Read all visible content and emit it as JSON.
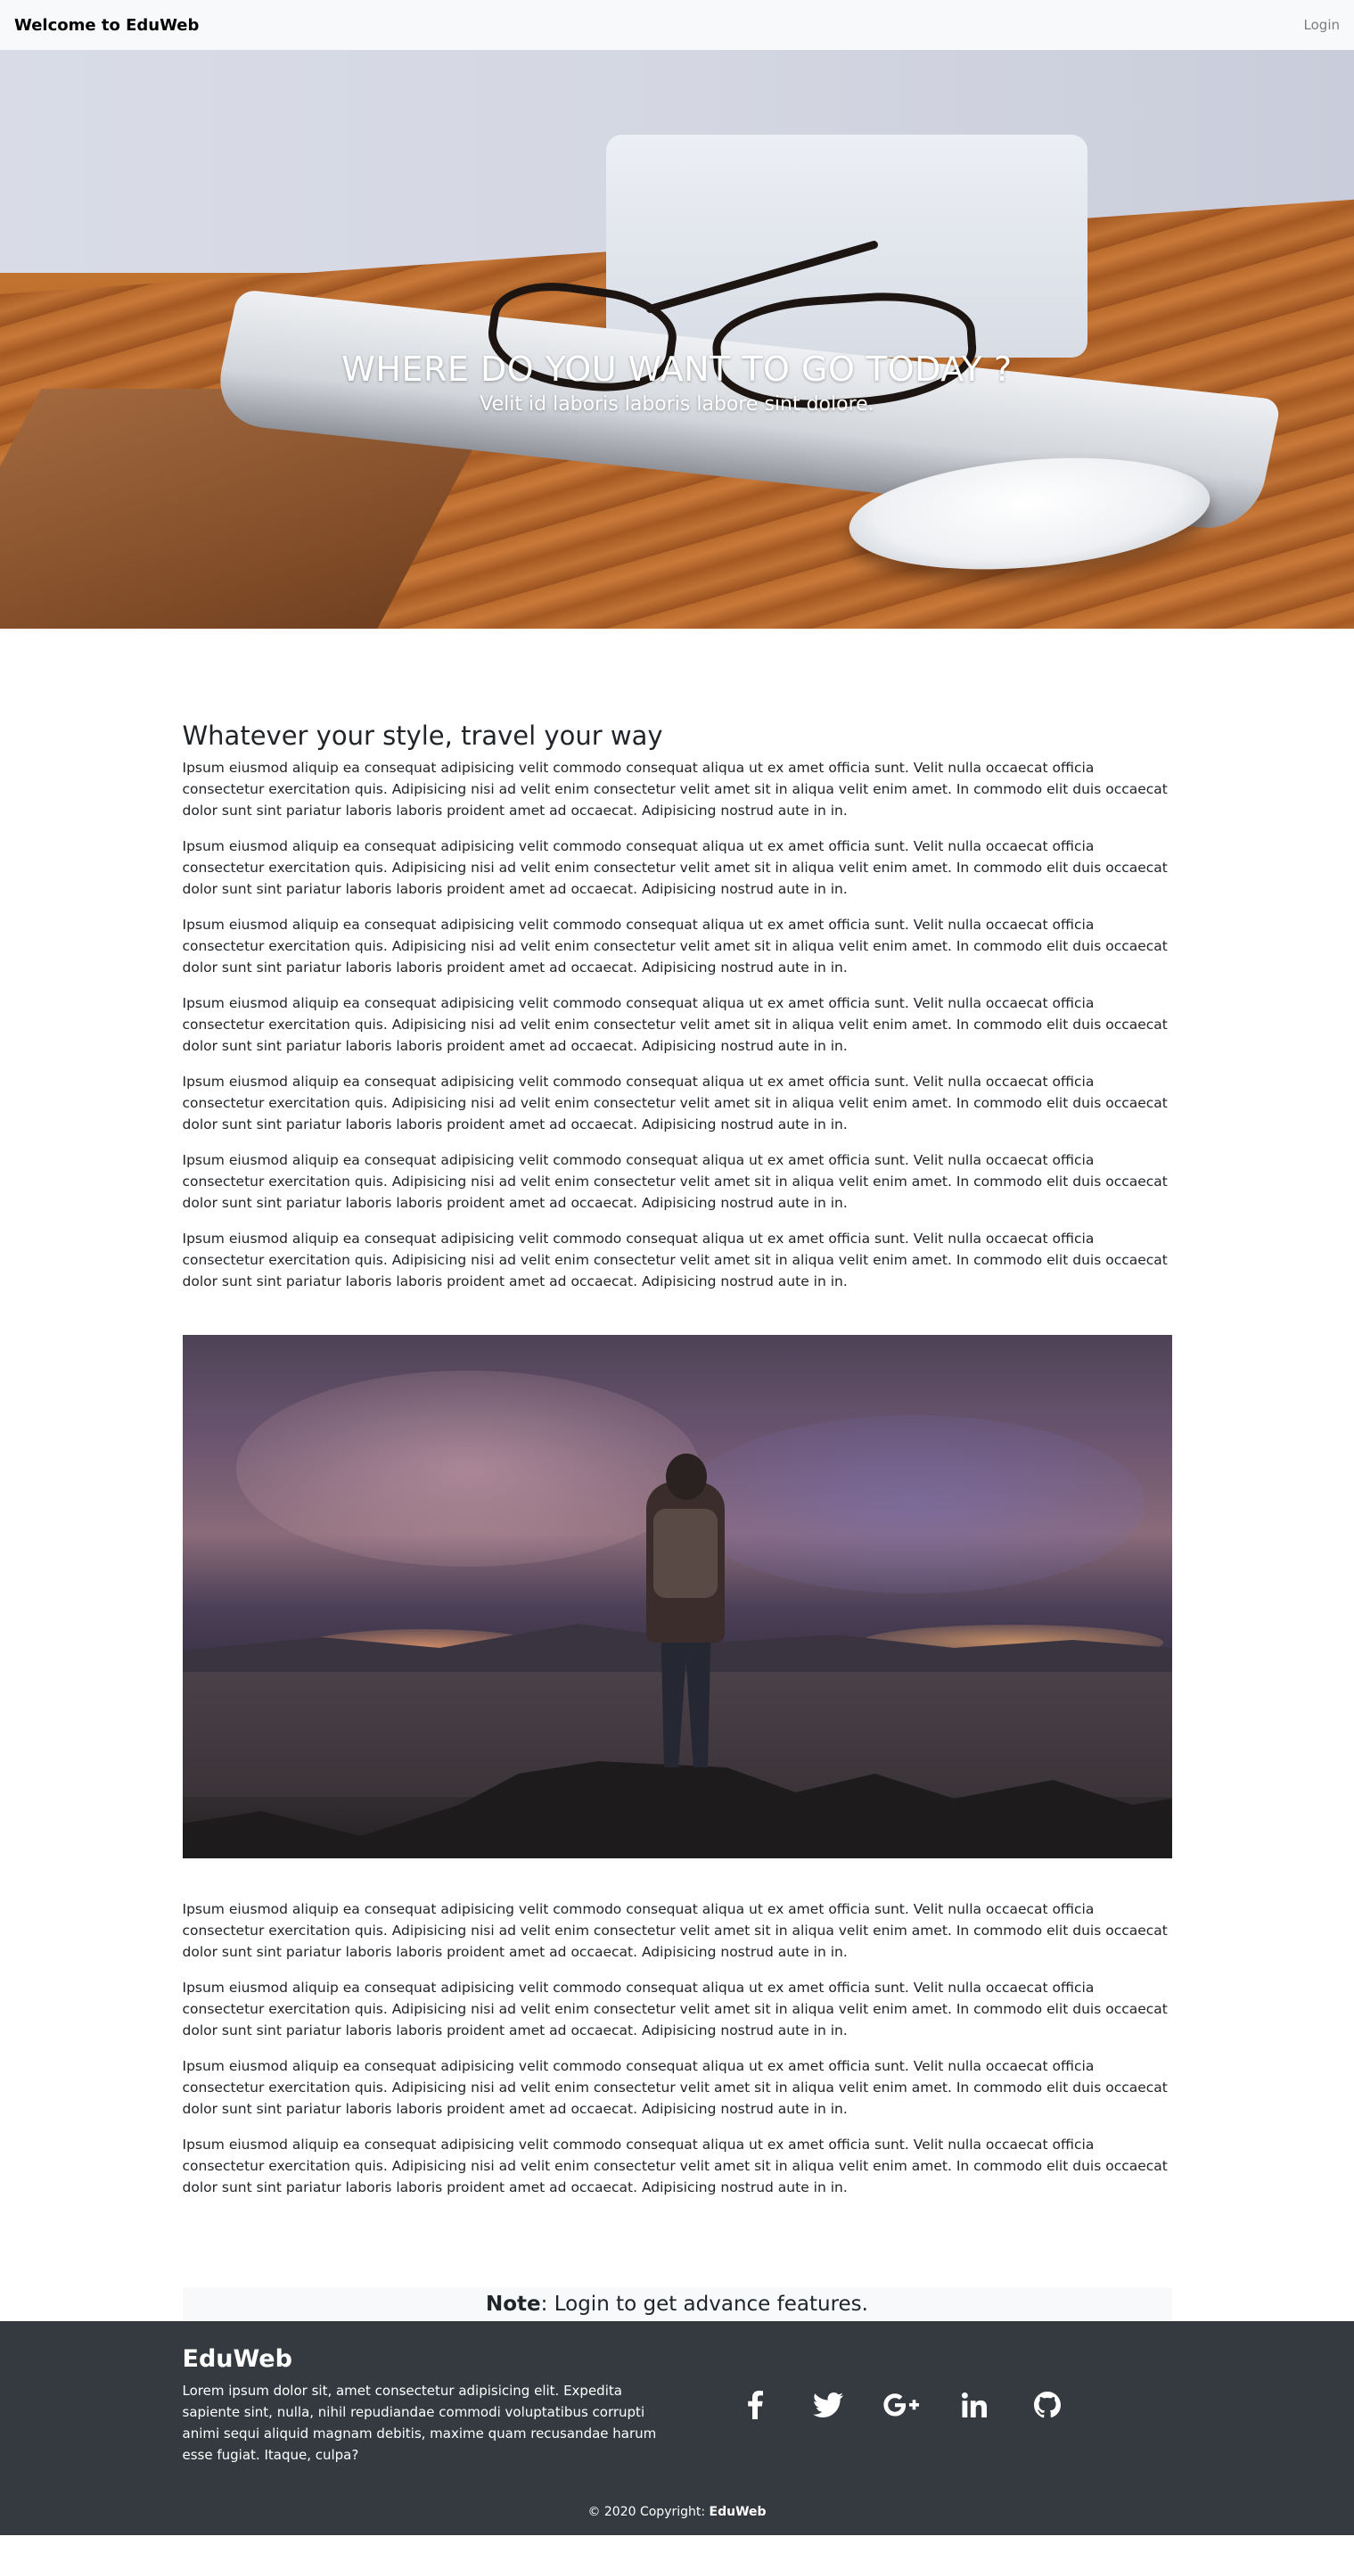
{
  "navbar": {
    "brand": "Welcome to EduWeb",
    "login": "Login"
  },
  "hero": {
    "title": "WHERE DO YOU WANT TO GO TODAY ?",
    "subtitle": "Velit id laboris laboris labore sint dolore."
  },
  "content": {
    "section_title": "Whatever your style, travel your way",
    "paragraphs_top": [
      "Ipsum eiusmod aliquip ea consequat adipisicing velit commodo consequat aliqua ut ex amet officia sunt. Velit nulla occaecat officia consectetur exercitation quis. Adipisicing nisi ad velit enim consectetur velit amet sit in aliqua velit enim amet. In commodo elit duis occaecat dolor sunt sint pariatur laboris laboris proident amet ad occaecat. Adipisicing nostrud aute in in.",
      "Ipsum eiusmod aliquip ea consequat adipisicing velit commodo consequat aliqua ut ex amet officia sunt. Velit nulla occaecat officia consectetur exercitation quis. Adipisicing nisi ad velit enim consectetur velit amet sit in aliqua velit enim amet. In commodo elit duis occaecat dolor sunt sint pariatur laboris laboris proident amet ad occaecat. Adipisicing nostrud aute in in.",
      "Ipsum eiusmod aliquip ea consequat adipisicing velit commodo consequat aliqua ut ex amet officia sunt. Velit nulla occaecat officia consectetur exercitation quis. Adipisicing nisi ad velit enim consectetur velit amet sit in aliqua velit enim amet. In commodo elit duis occaecat dolor sunt sint pariatur laboris laboris proident amet ad occaecat. Adipisicing nostrud aute in in.",
      "Ipsum eiusmod aliquip ea consequat adipisicing velit commodo consequat aliqua ut ex amet officia sunt. Velit nulla occaecat officia consectetur exercitation quis. Adipisicing nisi ad velit enim consectetur velit amet sit in aliqua velit enim amet. In commodo elit duis occaecat dolor sunt sint pariatur laboris laboris proident amet ad occaecat. Adipisicing nostrud aute in in.",
      "Ipsum eiusmod aliquip ea consequat adipisicing velit commodo consequat aliqua ut ex amet officia sunt. Velit nulla occaecat officia consectetur exercitation quis. Adipisicing nisi ad velit enim consectetur velit amet sit in aliqua velit enim amet. In commodo elit duis occaecat dolor sunt sint pariatur laboris laboris proident amet ad occaecat. Adipisicing nostrud aute in in.",
      "Ipsum eiusmod aliquip ea consequat adipisicing velit commodo consequat aliqua ut ex amet officia sunt. Velit nulla occaecat officia consectetur exercitation quis. Adipisicing nisi ad velit enim consectetur velit amet sit in aliqua velit enim amet. In commodo elit duis occaecat dolor sunt sint pariatur laboris laboris proident amet ad occaecat. Adipisicing nostrud aute in in.",
      "Ipsum eiusmod aliquip ea consequat adipisicing velit commodo consequat aliqua ut ex amet officia sunt. Velit nulla occaecat officia consectetur exercitation quis. Adipisicing nisi ad velit enim consectetur velit amet sit in aliqua velit enim amet. In commodo elit duis occaecat dolor sunt sint pariatur laboris laboris proident amet ad occaecat. Adipisicing nostrud aute in in."
    ],
    "paragraphs_bottom": [
      "Ipsum eiusmod aliquip ea consequat adipisicing velit commodo consequat aliqua ut ex amet officia sunt. Velit nulla occaecat officia consectetur exercitation quis. Adipisicing nisi ad velit enim consectetur velit amet sit in aliqua velit enim amet. In commodo elit duis occaecat dolor sunt sint pariatur laboris laboris proident amet ad occaecat. Adipisicing nostrud aute in in.",
      "Ipsum eiusmod aliquip ea consequat adipisicing velit commodo consequat aliqua ut ex amet officia sunt. Velit nulla occaecat officia consectetur exercitation quis. Adipisicing nisi ad velit enim consectetur velit amet sit in aliqua velit enim amet. In commodo elit duis occaecat dolor sunt sint pariatur laboris laboris proident amet ad occaecat. Adipisicing nostrud aute in in.",
      "Ipsum eiusmod aliquip ea consequat adipisicing velit commodo consequat aliqua ut ex amet officia sunt. Velit nulla occaecat officia consectetur exercitation quis. Adipisicing nisi ad velit enim consectetur velit amet sit in aliqua velit enim amet. In commodo elit duis occaecat dolor sunt sint pariatur laboris laboris proident amet ad occaecat. Adipisicing nostrud aute in in.",
      "Ipsum eiusmod aliquip ea consequat adipisicing velit commodo consequat aliqua ut ex amet officia sunt. Velit nulla occaecat officia consectetur exercitation quis. Adipisicing nisi ad velit enim consectetur velit amet sit in aliqua velit enim amet. In commodo elit duis occaecat dolor sunt sint pariatur laboris laboris proident amet ad occaecat. Adipisicing nostrud aute in in."
    ]
  },
  "note": {
    "label": "Note",
    "text": ": Login to get advance features."
  },
  "footer": {
    "title": "EduWeb",
    "description": "Lorem ipsum dolor sit, amet consectetur adipisicing elit. Expedita sapiente sint, nulla, nihil repudiandae commodi voluptatibus corrupti animi sequi aliquid magnam debitis, maxime quam recusandae harum esse fugiat. Itaque, culpa?",
    "socials": [
      "facebook-icon",
      "twitter-icon",
      "google-plus-icon",
      "linkedin-icon",
      "github-icon"
    ],
    "copyright_prefix": "© 2020 Copyright: ",
    "copyright_brand": "EduWeb"
  },
  "colors": {
    "navbar_bg": "#f8f9fa",
    "footer_bg": "#343a40",
    "note_bg": "#f8f9fa",
    "login_link": "#7d7d7d"
  }
}
